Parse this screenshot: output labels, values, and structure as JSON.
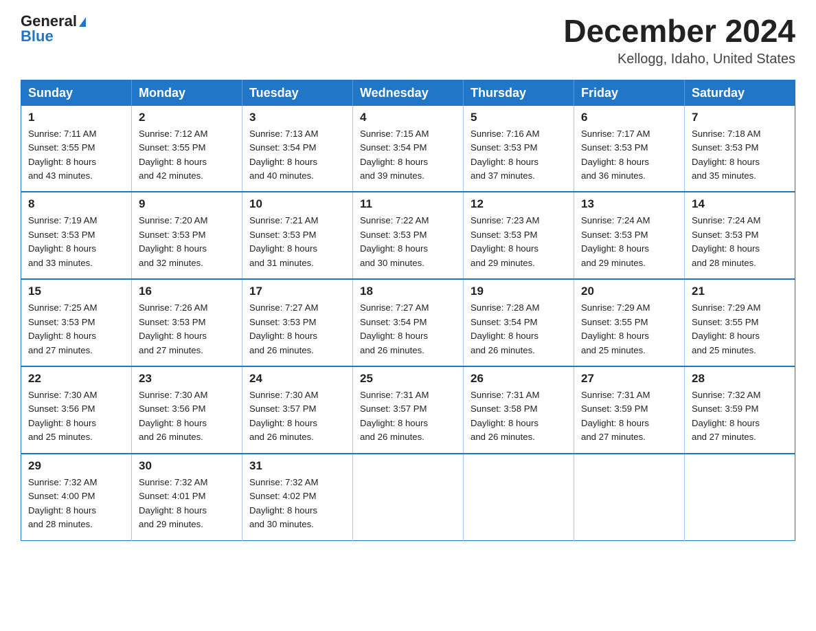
{
  "logo": {
    "general": "General",
    "blue": "Blue"
  },
  "title": "December 2024",
  "location": "Kellogg, Idaho, United States",
  "days_of_week": [
    "Sunday",
    "Monday",
    "Tuesday",
    "Wednesday",
    "Thursday",
    "Friday",
    "Saturday"
  ],
  "weeks": [
    [
      {
        "day": "1",
        "sunrise": "7:11 AM",
        "sunset": "3:55 PM",
        "daylight": "8 hours and 43 minutes."
      },
      {
        "day": "2",
        "sunrise": "7:12 AM",
        "sunset": "3:55 PM",
        "daylight": "8 hours and 42 minutes."
      },
      {
        "day": "3",
        "sunrise": "7:13 AM",
        "sunset": "3:54 PM",
        "daylight": "8 hours and 40 minutes."
      },
      {
        "day": "4",
        "sunrise": "7:15 AM",
        "sunset": "3:54 PM",
        "daylight": "8 hours and 39 minutes."
      },
      {
        "day": "5",
        "sunrise": "7:16 AM",
        "sunset": "3:53 PM",
        "daylight": "8 hours and 37 minutes."
      },
      {
        "day": "6",
        "sunrise": "7:17 AM",
        "sunset": "3:53 PM",
        "daylight": "8 hours and 36 minutes."
      },
      {
        "day": "7",
        "sunrise": "7:18 AM",
        "sunset": "3:53 PM",
        "daylight": "8 hours and 35 minutes."
      }
    ],
    [
      {
        "day": "8",
        "sunrise": "7:19 AM",
        "sunset": "3:53 PM",
        "daylight": "8 hours and 33 minutes."
      },
      {
        "day": "9",
        "sunrise": "7:20 AM",
        "sunset": "3:53 PM",
        "daylight": "8 hours and 32 minutes."
      },
      {
        "day": "10",
        "sunrise": "7:21 AM",
        "sunset": "3:53 PM",
        "daylight": "8 hours and 31 minutes."
      },
      {
        "day": "11",
        "sunrise": "7:22 AM",
        "sunset": "3:53 PM",
        "daylight": "8 hours and 30 minutes."
      },
      {
        "day": "12",
        "sunrise": "7:23 AM",
        "sunset": "3:53 PM",
        "daylight": "8 hours and 29 minutes."
      },
      {
        "day": "13",
        "sunrise": "7:24 AM",
        "sunset": "3:53 PM",
        "daylight": "8 hours and 29 minutes."
      },
      {
        "day": "14",
        "sunrise": "7:24 AM",
        "sunset": "3:53 PM",
        "daylight": "8 hours and 28 minutes."
      }
    ],
    [
      {
        "day": "15",
        "sunrise": "7:25 AM",
        "sunset": "3:53 PM",
        "daylight": "8 hours and 27 minutes."
      },
      {
        "day": "16",
        "sunrise": "7:26 AM",
        "sunset": "3:53 PM",
        "daylight": "8 hours and 27 minutes."
      },
      {
        "day": "17",
        "sunrise": "7:27 AM",
        "sunset": "3:53 PM",
        "daylight": "8 hours and 26 minutes."
      },
      {
        "day": "18",
        "sunrise": "7:27 AM",
        "sunset": "3:54 PM",
        "daylight": "8 hours and 26 minutes."
      },
      {
        "day": "19",
        "sunrise": "7:28 AM",
        "sunset": "3:54 PM",
        "daylight": "8 hours and 26 minutes."
      },
      {
        "day": "20",
        "sunrise": "7:29 AM",
        "sunset": "3:55 PM",
        "daylight": "8 hours and 25 minutes."
      },
      {
        "day": "21",
        "sunrise": "7:29 AM",
        "sunset": "3:55 PM",
        "daylight": "8 hours and 25 minutes."
      }
    ],
    [
      {
        "day": "22",
        "sunrise": "7:30 AM",
        "sunset": "3:56 PM",
        "daylight": "8 hours and 25 minutes."
      },
      {
        "day": "23",
        "sunrise": "7:30 AM",
        "sunset": "3:56 PM",
        "daylight": "8 hours and 26 minutes."
      },
      {
        "day": "24",
        "sunrise": "7:30 AM",
        "sunset": "3:57 PM",
        "daylight": "8 hours and 26 minutes."
      },
      {
        "day": "25",
        "sunrise": "7:31 AM",
        "sunset": "3:57 PM",
        "daylight": "8 hours and 26 minutes."
      },
      {
        "day": "26",
        "sunrise": "7:31 AM",
        "sunset": "3:58 PM",
        "daylight": "8 hours and 26 minutes."
      },
      {
        "day": "27",
        "sunrise": "7:31 AM",
        "sunset": "3:59 PM",
        "daylight": "8 hours and 27 minutes."
      },
      {
        "day": "28",
        "sunrise": "7:32 AM",
        "sunset": "3:59 PM",
        "daylight": "8 hours and 27 minutes."
      }
    ],
    [
      {
        "day": "29",
        "sunrise": "7:32 AM",
        "sunset": "4:00 PM",
        "daylight": "8 hours and 28 minutes."
      },
      {
        "day": "30",
        "sunrise": "7:32 AM",
        "sunset": "4:01 PM",
        "daylight": "8 hours and 29 minutes."
      },
      {
        "day": "31",
        "sunrise": "7:32 AM",
        "sunset": "4:02 PM",
        "daylight": "8 hours and 30 minutes."
      },
      null,
      null,
      null,
      null
    ]
  ],
  "labels": {
    "sunrise": "Sunrise:",
    "sunset": "Sunset:",
    "daylight": "Daylight:"
  }
}
